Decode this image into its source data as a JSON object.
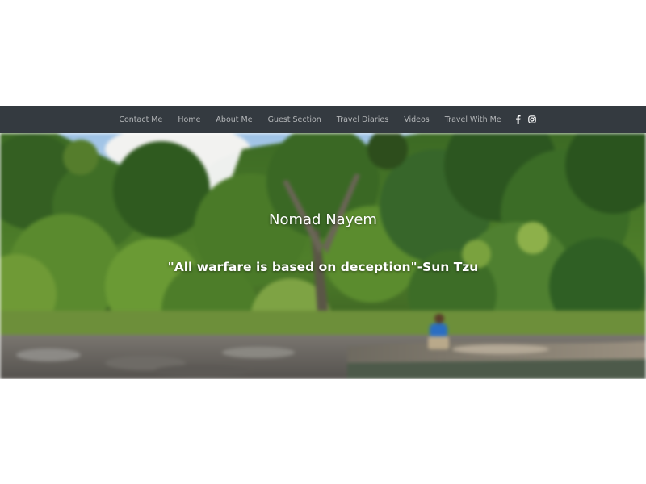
{
  "navbar": {
    "bg_color": "#343a40",
    "items": [
      {
        "label": "Contact Me"
      },
      {
        "label": "Home"
      },
      {
        "label": "About Me"
      },
      {
        "label": "Guest Section"
      },
      {
        "label": "Travel Diaries"
      },
      {
        "label": "Videos"
      },
      {
        "label": "Travel With Me"
      }
    ],
    "social": [
      {
        "icon": "facebook-icon"
      },
      {
        "icon": "instagram-icon"
      }
    ]
  },
  "hero": {
    "title": "Nomad Nayem",
    "quote": "\"All warfare is based on deception\"-Sun Tzu",
    "text_color": "#ffffff"
  }
}
